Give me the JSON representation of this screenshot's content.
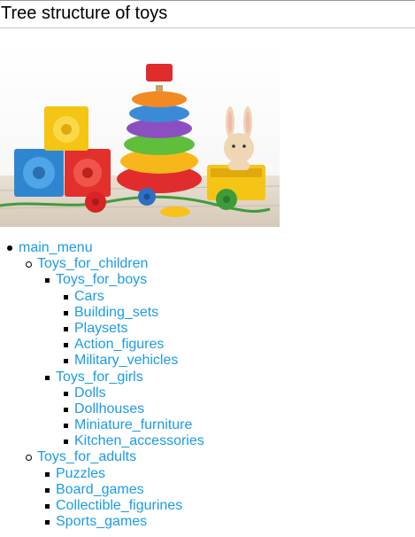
{
  "page": {
    "title": "Tree structure of toys"
  },
  "image": {
    "description": "stacking-rings-blocks-bunny"
  },
  "menu": {
    "root": "main_menu",
    "children": {
      "label": "Toys_for_children",
      "boys": {
        "label": "Toys_for_boys",
        "items": [
          "Cars",
          "Building_sets",
          "Playsets",
          "Action_figures",
          "Military_vehicles"
        ]
      },
      "girls": {
        "label": "Toys_for_girls",
        "items": [
          "Dolls",
          "Dollhouses",
          "Miniature_furniture",
          "Kitchen_accessories"
        ]
      }
    },
    "adults": {
      "label": "Toys_for_adults",
      "items": [
        "Puzzles",
        "Board_games",
        "Collectible_figurines",
        "Sports_games"
      ]
    }
  },
  "colors": {
    "link": "#1a9be8"
  }
}
